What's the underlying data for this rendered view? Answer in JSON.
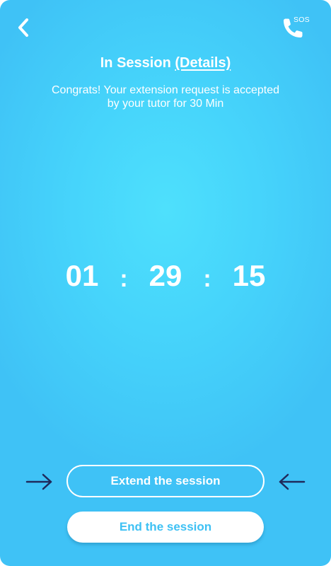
{
  "header": {
    "back_icon": "chevron-left-icon",
    "sos_icon": "phone-icon",
    "sos_label": "SOS"
  },
  "session": {
    "title": "In Session",
    "details_link": "(Details)",
    "message": "Congrats! Your extension request is accepted by your tutor for 30 Min"
  },
  "timer": {
    "hours": "01",
    "minutes": "29",
    "seconds": "15",
    "separator": ":"
  },
  "actions": {
    "extend_label": "Extend the session",
    "end_label": "End the session",
    "pointer_icon": "arrow-icon"
  },
  "colors": {
    "background": "#46d4fb",
    "button_text": "#3ec1f4",
    "arrow": "#1f2a5c",
    "text": "#ffffff"
  }
}
